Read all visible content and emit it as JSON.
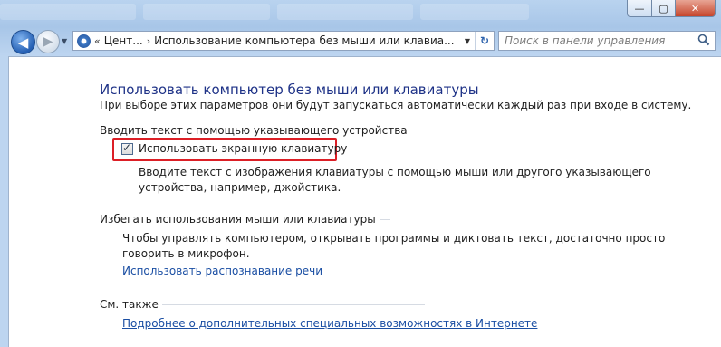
{
  "window": {
    "min_symbol": "—",
    "max_symbol": "▢",
    "close_symbol": "✕"
  },
  "nav": {
    "back_symbol": "◀",
    "forward_symbol": "▶",
    "dropdown_symbol": "▼"
  },
  "address": {
    "separator_1": "«",
    "segment_1": "Цент...",
    "separator_2": "›",
    "segment_2": "Использование компьютера без мыши или клавиа...",
    "dropdown_symbol": "▼",
    "refresh_symbol": "↻"
  },
  "search": {
    "placeholder": "Поиск в панели управления"
  },
  "page": {
    "title": "Использовать компьютер без мыши или клавиатуры",
    "description": "При выборе этих параметров они будут запускаться автоматически каждый раз при входе в систему."
  },
  "sections": {
    "pointer": {
      "title": "Вводить текст с помощью указывающего устройства",
      "checkbox_label": "Использовать экранную клавиатуру",
      "checkbox_checked": true,
      "checkmark": "✓",
      "desc_line1": "Вводите текст с изображения клавиатуры с помощью мыши или другого указывающего",
      "desc_line2": "устройства, например, джойстика."
    },
    "avoid": {
      "title": "Избегать использования мыши или клавиатуры",
      "desc_line1": "Чтобы управлять компьютером, открывать программы и диктовать текст, достаточно просто",
      "desc_line2": "говорить в микрофон.",
      "link": "Использовать распознавание речи"
    },
    "see_also": {
      "title": "См. также",
      "link": "Подробнее о дополнительных специальных возможностях в Интернете"
    }
  },
  "colors": {
    "title_blue": "#1e3287",
    "link_blue": "#1a4ea3",
    "highlight_red": "#dc1f26"
  }
}
